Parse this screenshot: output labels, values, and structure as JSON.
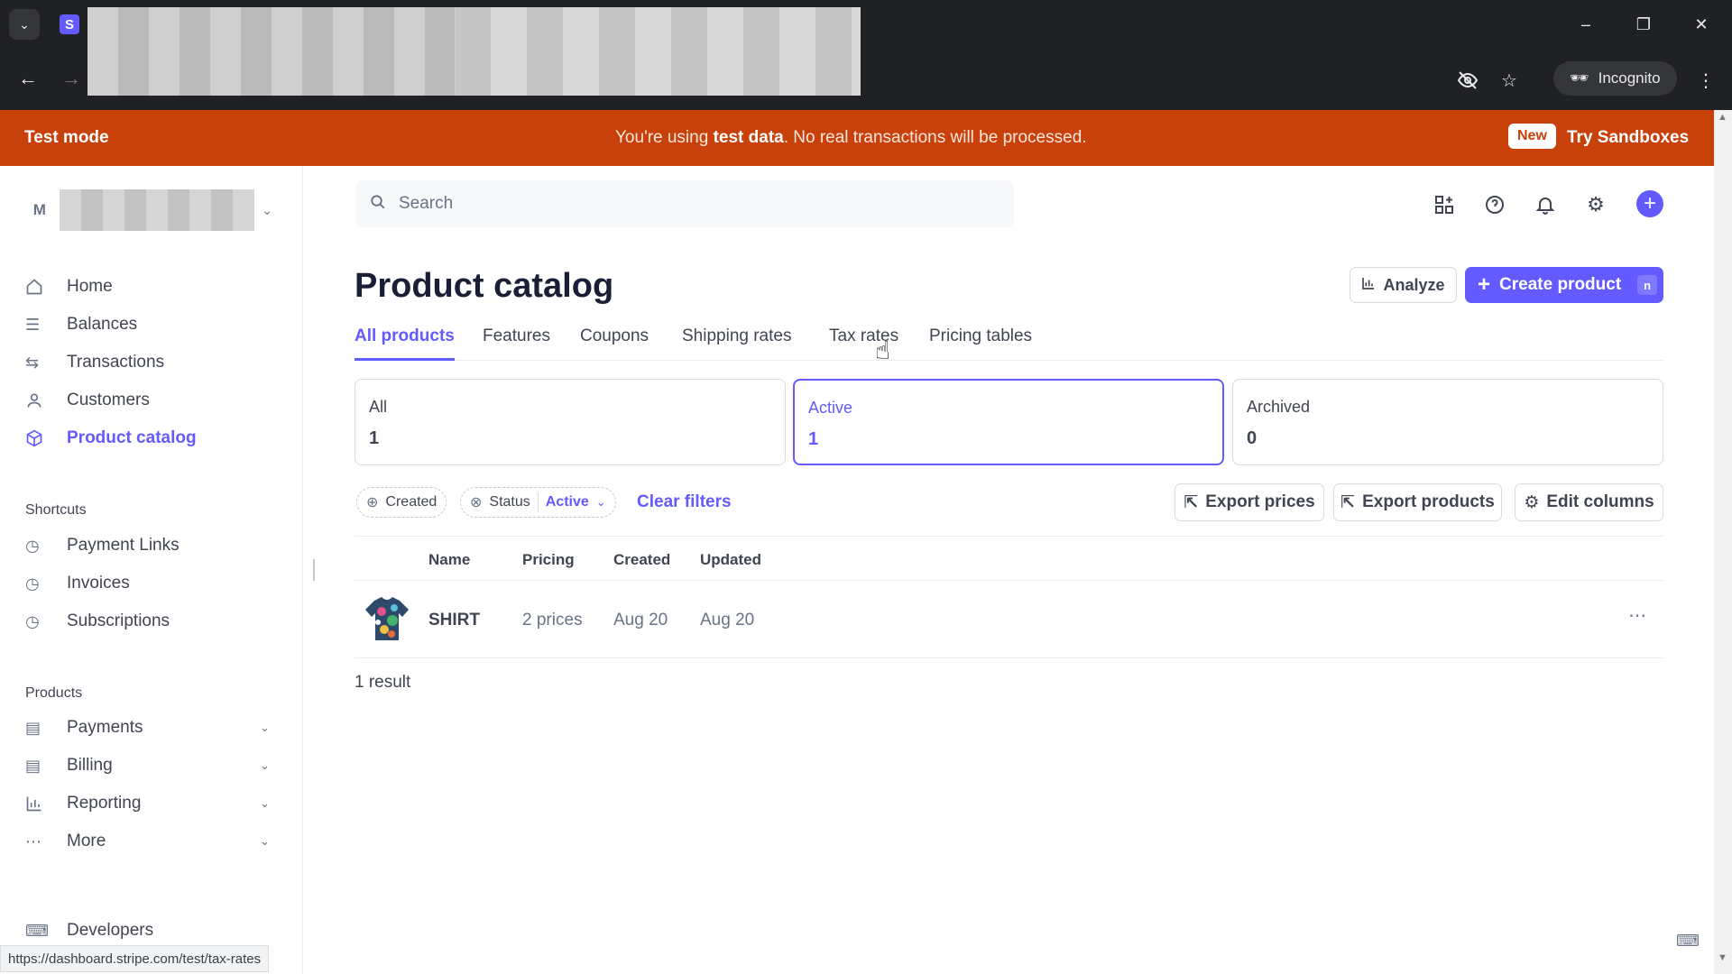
{
  "browser": {
    "incognito_label": "Incognito",
    "status_url": "https://dashboard.stripe.com/test/tax-rates"
  },
  "banner": {
    "left": "Test mode",
    "center_pre": "You're using ",
    "center_bold": "test data",
    "center_post": ". No real transactions will be processed.",
    "new_badge": "New",
    "try_link": "Try Sandboxes"
  },
  "account": {
    "initial": "M"
  },
  "sidebar": {
    "items": [
      {
        "label": "Home"
      },
      {
        "label": "Balances"
      },
      {
        "label": "Transactions"
      },
      {
        "label": "Customers"
      },
      {
        "label": "Product catalog"
      }
    ],
    "shortcuts_header": "Shortcuts",
    "shortcuts": [
      {
        "label": "Payment Links"
      },
      {
        "label": "Invoices"
      },
      {
        "label": "Subscriptions"
      }
    ],
    "products_header": "Products",
    "products": [
      {
        "label": "Payments"
      },
      {
        "label": "Billing"
      },
      {
        "label": "Reporting"
      },
      {
        "label": "More"
      }
    ],
    "developers": "Developers"
  },
  "search": {
    "placeholder": "Search"
  },
  "page": {
    "title": "Product catalog",
    "analyze": "Analyze",
    "create": "Create product",
    "create_shortcut": "n"
  },
  "tabs": [
    "All products",
    "Features",
    "Coupons",
    "Shipping rates",
    "Tax rates",
    "Pricing tables"
  ],
  "cards": [
    {
      "label": "All",
      "value": "1"
    },
    {
      "label": "Active",
      "value": "1"
    },
    {
      "label": "Archived",
      "value": "0"
    }
  ],
  "filters": {
    "created": "Created",
    "status": "Status",
    "status_value": "Active",
    "clear": "Clear filters"
  },
  "table_actions": {
    "export_prices": "Export prices",
    "export_products": "Export products",
    "edit_columns": "Edit columns"
  },
  "table": {
    "columns": [
      "Name",
      "Pricing",
      "Created",
      "Updated"
    ],
    "rows": [
      {
        "name": "SHIRT",
        "pricing": "2 prices",
        "created": "Aug 20",
        "updated": "Aug 20"
      }
    ],
    "result_count": "1 result"
  },
  "colors": {
    "accent": "#635bff",
    "banner": "#c8410b"
  }
}
